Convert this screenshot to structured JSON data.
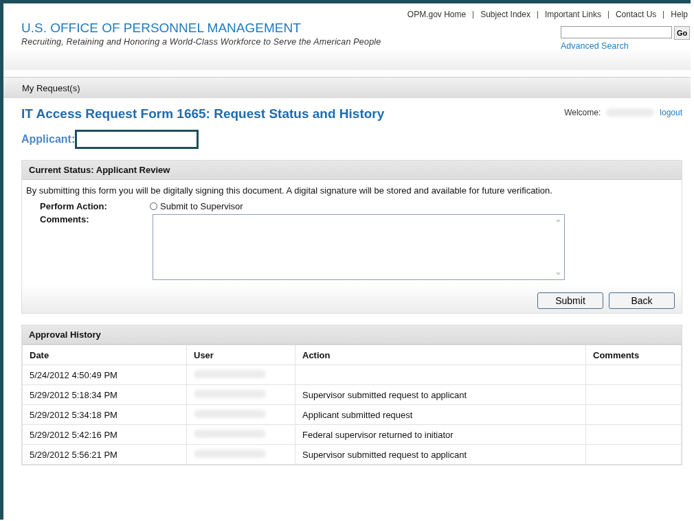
{
  "top_links": [
    "OPM.gov Home",
    "Subject Index",
    "Important Links",
    "Contact Us",
    "Help"
  ],
  "header": {
    "title": "U.S. OFFICE OF PERSONNEL MANAGEMENT",
    "tagline": "Recruiting, Retaining and Honoring a World-Class Workforce to Serve the American People"
  },
  "search": {
    "button": "Go",
    "advanced_link": "Advanced Search"
  },
  "nav": {
    "items": [
      "My Request(s)"
    ]
  },
  "page_title": "IT Access Request Form 1665: Request Status and History",
  "welcome": {
    "label": "Welcome:",
    "logout": "logout"
  },
  "applicant": {
    "label": "Applicant:"
  },
  "status_panel": {
    "title": "Current Status: Applicant Review",
    "notice": "By submitting this form you will be digitally signing this document. A digital signature will be stored and available for future verification.",
    "action_label": "Perform Action:",
    "actions": [
      {
        "label": "Submit to Supervisor",
        "selected": false
      }
    ],
    "comments_label": "Comments:",
    "buttons": [
      "Submit",
      "Back"
    ]
  },
  "history": {
    "title": "Approval History",
    "columns": [
      "Date",
      "User",
      "Action",
      "Comments"
    ],
    "rows": [
      {
        "date": "5/24/2012 4:50:49 PM"
      },
      {
        "date": "5/29/2012 5:18:34 PM",
        "action": "Supervisor submitted request to applicant"
      },
      {
        "date": "5/29/2012 5:34:18 PM",
        "action": "Applicant submitted request"
      },
      {
        "date": "5/29/2012 5:42:16 PM",
        "action": "Federal supervisor returned to initiator"
      },
      {
        "date": "5/29/2012 5:56:21 PM",
        "action": "Supervisor submitted request to applicant"
      }
    ]
  }
}
